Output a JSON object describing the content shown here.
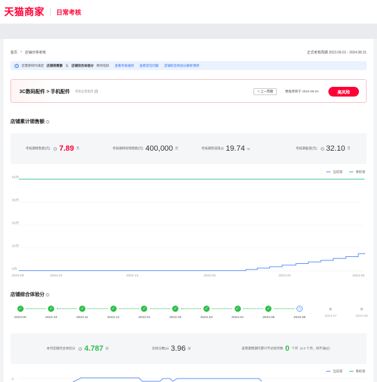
{
  "header": {
    "logo": "天猫商家",
    "subtitle": "日常考核"
  },
  "breadcrumb": {
    "home": "首页",
    "current": "店铺日常考核"
  },
  "period": "正式考核周期 2023.09.01 - 2024.08.31",
  "notice": {
    "text_prefix": "您需要同时满足",
    "metric_a": "店铺销售额",
    "connector": "与",
    "metric_b": "店铺综合体验分",
    "text_suffix": "两项指标",
    "links": [
      "查看考核规则",
      "查看常见问题",
      "店铺综合体验分解析更新"
    ]
  },
  "category": {
    "title": "3C数码配件 > 手机配件",
    "hint": "考核主营类目",
    "prev_button": "< 上一周期",
    "updated": "数据更新于 2024-06-04",
    "risk_badge": "高风险"
  },
  "sales": {
    "title": "店铺累计销售额",
    "stats": [
      {
        "label": "考核期销售额(元)",
        "value": "7.89",
        "unit": "万"
      },
      {
        "label": "考核期目标销售额(元)",
        "value": "400,000",
        "unit": "元"
      },
      {
        "label": "考核期完成值占",
        "value": "19.74",
        "unit": "%"
      },
      {
        "label": "考核期差值(元)",
        "value": "32.10",
        "unit": "万"
      }
    ],
    "legend": {
      "current": "当前值",
      "target": "目标值"
    }
  },
  "chart_data": {
    "type": "line",
    "y_ticks": [
      "40万",
      "30万",
      "20万",
      "10万",
      "0万"
    ],
    "ylim": [
      0,
      40
    ],
    "x_ticks": [
      "2023.09",
      "2023.10",
      "2023.12",
      "2024.02",
      "2024.04",
      "2024.06"
    ],
    "series": [
      {
        "name": "当前值",
        "color": "#5b8ff9",
        "x": [
          "2023-09-01",
          "2024-02-25",
          "2024-03-01",
          "2024-03-10",
          "2024-03-20",
          "2024-03-30",
          "2024-04-10",
          "2024-04-20",
          "2024-04-30",
          "2024-05-10",
          "2024-05-20",
          "2024-05-30",
          "2024-06-04"
        ],
        "values": [
          0.1,
          0.1,
          0.6,
          1.2,
          1.8,
          2.5,
          3.2,
          3.9,
          4.6,
          5.4,
          6.2,
          7.5,
          7.89
        ]
      },
      {
        "name": "目标值",
        "color": "#38c0a0",
        "x": [
          "2023-09-01",
          "2024-06-04"
        ],
        "values": [
          40,
          40
        ]
      }
    ],
    "grid": true
  },
  "experience": {
    "title": "店铺综合体验分",
    "timeline": [
      {
        "label": "2023.09",
        "status": "done"
      },
      {
        "label": "2023.10",
        "status": "done"
      },
      {
        "label": "2023.11",
        "status": "done"
      },
      {
        "label": "2023.12",
        "status": "done"
      },
      {
        "label": "2024.01",
        "status": "done"
      },
      {
        "label": "2024.02",
        "status": "done"
      },
      {
        "label": "2024.03",
        "status": "done"
      },
      {
        "label": "2024.04",
        "status": "done"
      },
      {
        "label": "2024.05",
        "status": "done"
      },
      {
        "label": "2024.06",
        "status": "current"
      },
      {
        "label": "2024.07",
        "status": "future"
      },
      {
        "label": "2024.08",
        "status": "future"
      }
    ],
    "stats": {
      "month_label": "本月店铺综合体验分",
      "month_value": "4.787",
      "month_unit": "分",
      "standard_label": "达标分数(≥)",
      "standard_value": "3.96",
      "standard_unit": "分",
      "cycle_label": "该周期周期内累计不达标月数",
      "cycle_value": "0",
      "cycle_unit": "个月",
      "cycle_note": "(≥ 6 个月，则不通过)"
    },
    "legend": {
      "current": "当前值",
      "target": "目标值"
    },
    "chart_partial_tick": "5"
  },
  "colors": {
    "brand": "#ff0036",
    "link": "#2b6ef5",
    "success": "#2cbf4a",
    "line_current": "#5b8ff9",
    "line_target": "#38c0a0"
  }
}
